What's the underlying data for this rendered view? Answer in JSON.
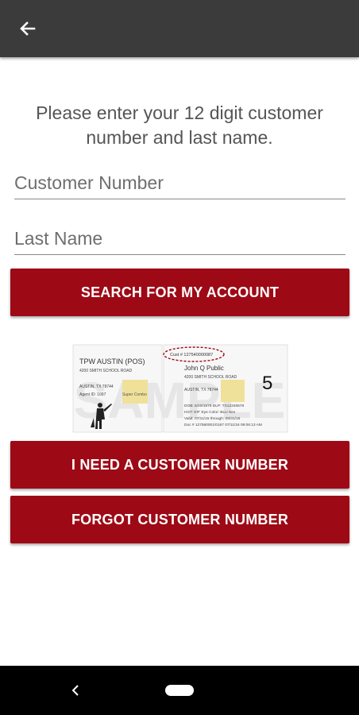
{
  "appbar": {
    "back_icon": "arrow-left-icon"
  },
  "instructions": "Please enter your 12 digit customer number and last name.",
  "form": {
    "customer_number": {
      "value": "",
      "placeholder": "Customer Number"
    },
    "last_name": {
      "value": "",
      "placeholder": "Last Name"
    }
  },
  "buttons": {
    "search": "SEARCH FOR MY ACCOUNT",
    "need_number": "I NEED A CUSTOMER NUMBER",
    "forgot_number": "FORGOT CUSTOMER NUMBER"
  },
  "sample_license": {
    "watermark": "SAMPLE",
    "left_card": {
      "header": "TPW AUSTIN (POS)",
      "address1": "4200 SMITH SCHOOL ROAD",
      "address2": "AUSTIN, TX 78744",
      "agent": "Agent ID: 1097",
      "combo": "Super Combo"
    },
    "right_card": {
      "cust_no": "Cust # 127540000087",
      "name": "John Q Public",
      "address1": "4200 SMITH SCHOOL ROAD",
      "address2": "AUSTIN, TX 78744",
      "line1": "DOB: 5/20/1979    DLP: TX12345678",
      "line2": "HGT: 5'9\"  Eye Color: BLU  Sex",
      "line3": "Valid: 07/11/15  through: 08/31/16",
      "line4": "Doc # 127580001/0187  07/11/16  09:06:13 AM",
      "big_number": "5"
    }
  },
  "colors": {
    "appbar": "#3b3b3b",
    "accent": "#9d0a16",
    "navbar": "#000000"
  },
  "navbar": {
    "back_icon": "nav-back-icon",
    "home_icon": "nav-home-pill"
  }
}
